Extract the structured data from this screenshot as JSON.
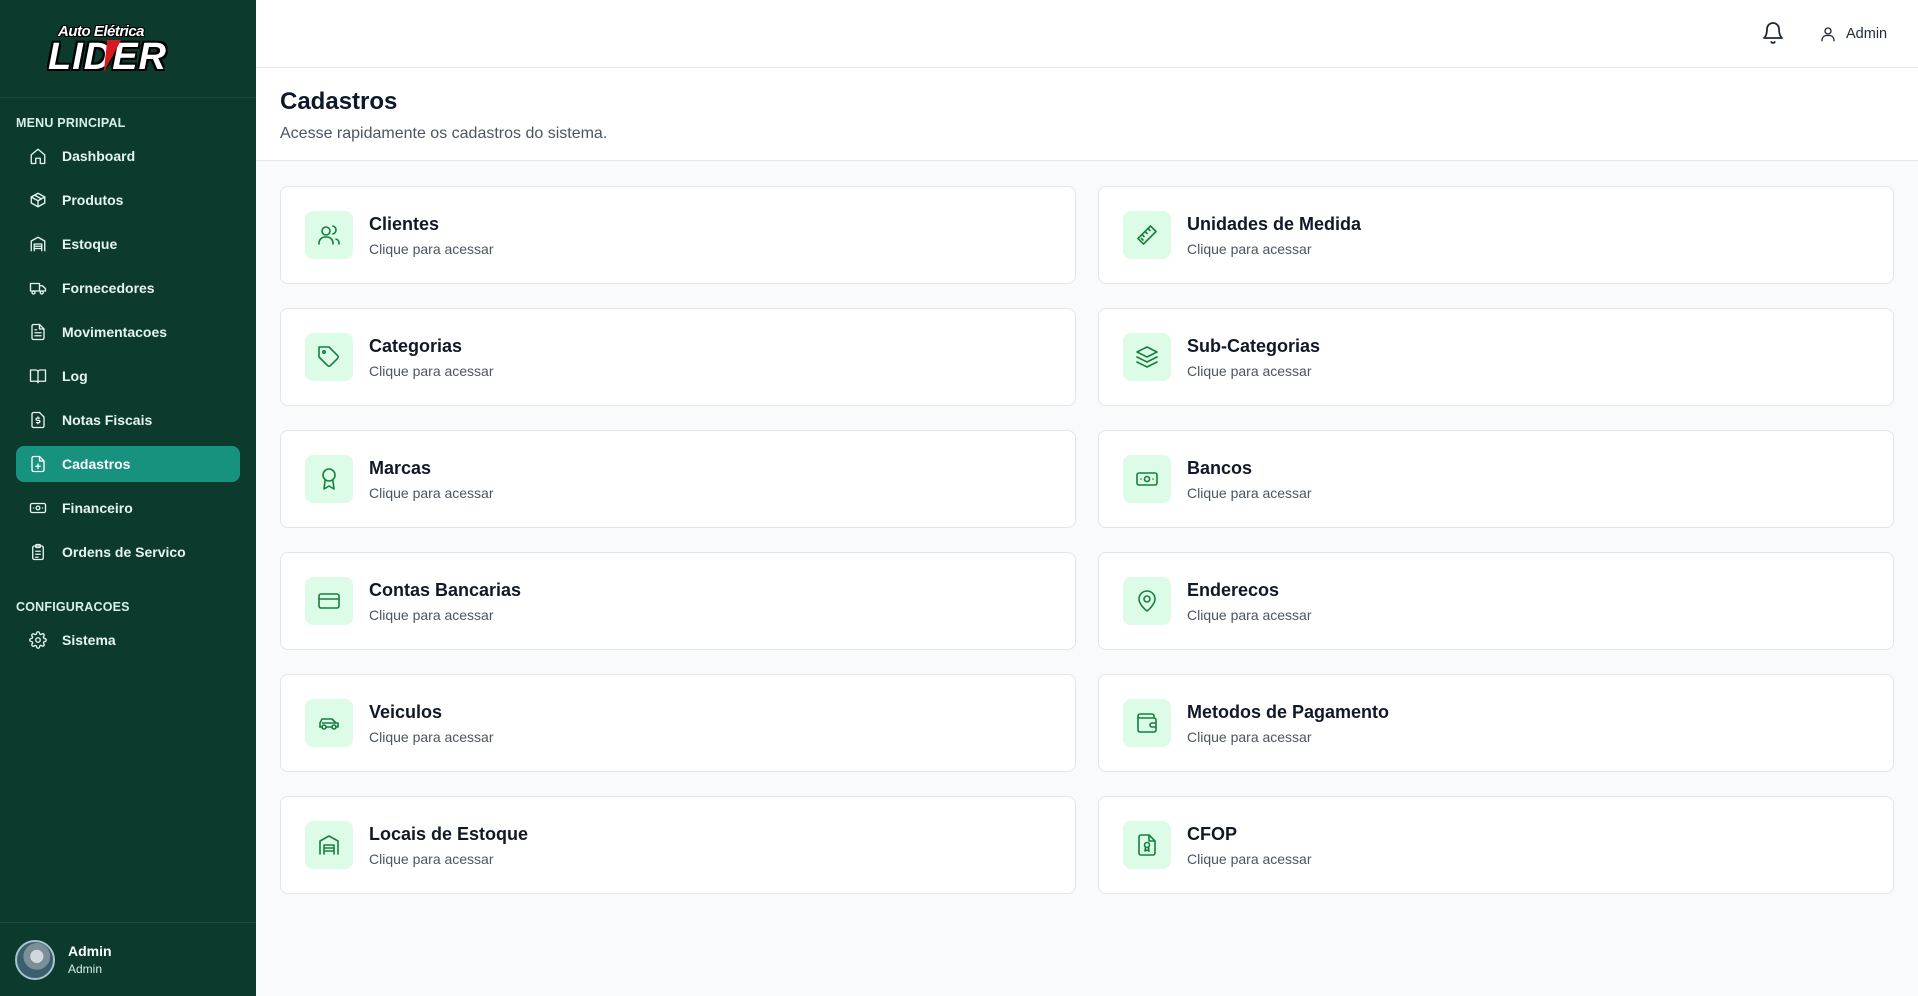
{
  "logo": {
    "line1": "Auto Elétrica",
    "line2": "LIDER"
  },
  "sidebar": {
    "section_main": "MENU PRINCIPAL",
    "items": [
      {
        "label": "Dashboard",
        "icon": "home-icon"
      },
      {
        "label": "Produtos",
        "icon": "package-icon"
      },
      {
        "label": "Estoque",
        "icon": "warehouse-icon"
      },
      {
        "label": "Fornecedores",
        "icon": "truck-icon"
      },
      {
        "label": "Movimentacoes",
        "icon": "file-list-icon"
      },
      {
        "label": "Log",
        "icon": "book-open-icon"
      },
      {
        "label": "Notas Fiscais",
        "icon": "receipt-dollar-icon"
      },
      {
        "label": "Cadastros",
        "icon": "file-plus-icon",
        "active": true
      },
      {
        "label": "Financeiro",
        "icon": "banknote-icon"
      },
      {
        "label": "Ordens de Servico",
        "icon": "clipboard-list-icon"
      }
    ],
    "section_config": "CONFIGURACOES",
    "config_items": [
      {
        "label": "Sistema",
        "icon": "gear-icon"
      }
    ],
    "user": {
      "name": "Admin",
      "role": "Admin"
    }
  },
  "header": {
    "user_label": "Admin"
  },
  "page": {
    "title": "Cadastros",
    "subtitle": "Acesse rapidamente os cadastros do sistema."
  },
  "cards": [
    {
      "title": "Clientes",
      "subtitle": "Clique para acessar",
      "icon": "users-icon"
    },
    {
      "title": "Unidades de Medida",
      "subtitle": "Clique para acessar",
      "icon": "ruler-icon"
    },
    {
      "title": "Categorias",
      "subtitle": "Clique para acessar",
      "icon": "tag-icon"
    },
    {
      "title": "Sub-Categorias",
      "subtitle": "Clique para acessar",
      "icon": "layers-icon"
    },
    {
      "title": "Marcas",
      "subtitle": "Clique para acessar",
      "icon": "award-icon"
    },
    {
      "title": "Bancos",
      "subtitle": "Clique para acessar",
      "icon": "banknote-icon"
    },
    {
      "title": "Contas Bancarias",
      "subtitle": "Clique para acessar",
      "icon": "credit-card-icon"
    },
    {
      "title": "Enderecos",
      "subtitle": "Clique para acessar",
      "icon": "map-pin-icon"
    },
    {
      "title": "Veiculos",
      "subtitle": "Clique para acessar",
      "icon": "car-icon"
    },
    {
      "title": "Metodos de Pagamento",
      "subtitle": "Clique para acessar",
      "icon": "wallet-icon"
    },
    {
      "title": "Locais de Estoque",
      "subtitle": "Clique para acessar",
      "icon": "warehouse-icon"
    },
    {
      "title": "CFOP",
      "subtitle": "Clique para acessar",
      "icon": "file-badge-icon"
    }
  ],
  "colors": {
    "sidebar_bg": "#0c3b2e",
    "active_item": "#16927f",
    "icon_bg": "#dcfce7",
    "icon_stroke": "#15803d"
  }
}
